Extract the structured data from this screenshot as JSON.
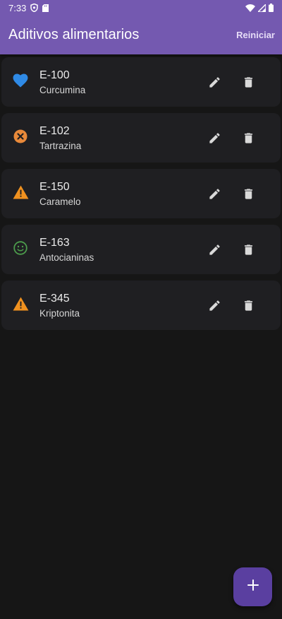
{
  "status_bar": {
    "time": "7:33"
  },
  "app_bar": {
    "title": "Aditivos alimentarios",
    "action_label": "Reiniciar"
  },
  "colors": {
    "app_bar": "#7459b0",
    "background": "#161616",
    "card": "#1f1f22",
    "fab": "#5a3fa0",
    "status_heart": "#2f8ae6",
    "status_dangerous": "#e8893a",
    "status_warning": "#f0911f",
    "status_ok": "#4c9c4c"
  },
  "additives": [
    {
      "code": "E-100",
      "name": "Curcumina",
      "status_icon": "heart-icon"
    },
    {
      "code": "E-102",
      "name": "Tartrazina",
      "status_icon": "cancel-circle-icon"
    },
    {
      "code": "E-150",
      "name": "Caramelo",
      "status_icon": "warning-icon"
    },
    {
      "code": "E-163",
      "name": "Antocianinas",
      "status_icon": "smiley-icon"
    },
    {
      "code": "E-345",
      "name": "Kriptonita",
      "status_icon": "warning-icon"
    }
  ],
  "icons": {
    "edit": "pencil-icon",
    "delete": "trash-icon",
    "fab": "plus-icon"
  }
}
